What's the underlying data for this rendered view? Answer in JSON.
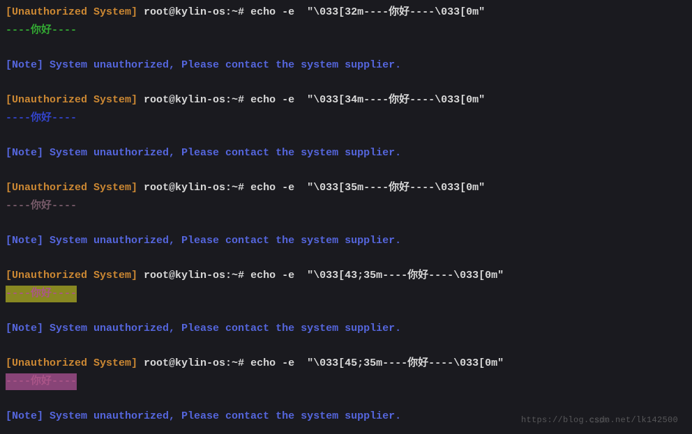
{
  "prompt_prefix": "[Unauthorized System]",
  "prompt_user": " root@kylin-os:~# ",
  "note_line": "[Note] System unauthorized, Please contact the system supplier.",
  "output_text": "----你好----",
  "commands": [
    {
      "cmd": "echo -e  \"\\033[32m----你好----\\033[0m\"",
      "fg_class": "green",
      "bg_class": ""
    },
    {
      "cmd": "echo -e  \"\\033[34m----你好----\\033[0m\"",
      "fg_class": "darkblue",
      "bg_class": ""
    },
    {
      "cmd": "echo -e  \"\\033[35m----你好----\\033[0m\"",
      "fg_class": "magenta-dim",
      "bg_class": ""
    },
    {
      "cmd": "echo -e  \"\\033[43;35m----你好----\\033[0m\"",
      "fg_class": "magenta",
      "bg_class": "bg-yellow"
    },
    {
      "cmd": "echo -e  \"\\033[45;35m----你好----\\033[0m\"",
      "fg_class": "magenta",
      "bg_class": "bg-magenta"
    }
  ],
  "watermark": "https://blog.csdn.net/lk142500",
  "watermark_logo": "CSDN"
}
